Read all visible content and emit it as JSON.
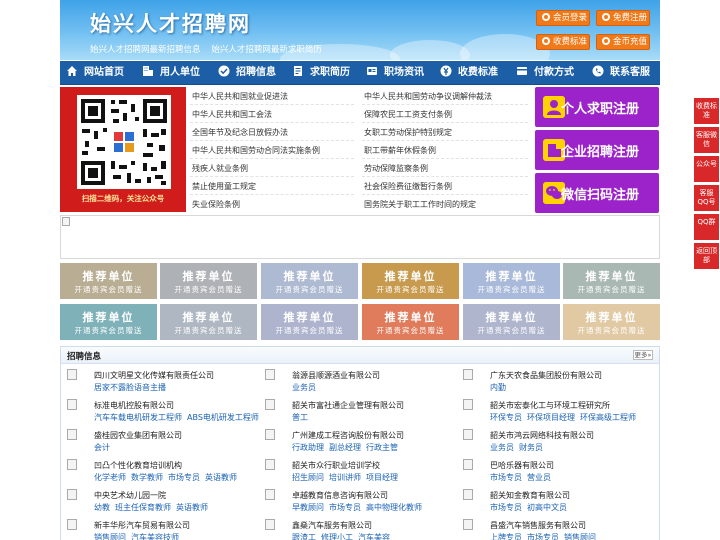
{
  "header": {
    "title": "始兴人才招聘网",
    "subtitle_1": "始兴人才招聘网最新招聘信息",
    "subtitle_2": "始兴人才招聘网最新求职简历",
    "buttons": [
      {
        "label": "会员登录",
        "icon": "user-icon"
      },
      {
        "label": "免费注册",
        "icon": "register-icon"
      },
      {
        "label": "收费标准",
        "icon": "price-icon"
      },
      {
        "label": "金币充值",
        "icon": "coin-icon"
      }
    ]
  },
  "nav": [
    {
      "label": "网站首页",
      "icon": "home-icon"
    },
    {
      "label": "用人单位",
      "icon": "building-icon"
    },
    {
      "label": "招聘信息",
      "icon": "recruit-icon"
    },
    {
      "label": "求职简历",
      "icon": "resume-icon"
    },
    {
      "label": "职场资讯",
      "icon": "news-icon"
    },
    {
      "label": "收费标准",
      "icon": "price-icon"
    },
    {
      "label": "付款方式",
      "icon": "payment-icon"
    },
    {
      "label": "联系客服",
      "icon": "phone-icon"
    }
  ],
  "qr": {
    "caption": "扫描二维码，关注公众号"
  },
  "laws": {
    "left": [
      "中华人民共和国就业促进法",
      "中华人民共和国工会法",
      "全国年节及纪念日放假办法",
      "中华人民共和国劳动合同法实施条例",
      "残疾人就业条例",
      "禁止使用童工规定",
      "失业保险条例"
    ],
    "right": [
      "中华人民共和国劳动争议调解仲裁法",
      "保障农民工工资支付条例",
      "女职工劳动保护特别规定",
      "职工带薪年休假条例",
      "劳动保障监察条例",
      "社会保险费征缴暂行条例",
      "国务院关于职工工作时间的规定"
    ]
  },
  "register": [
    {
      "label": "个人求职注册",
      "icon": "person-icon"
    },
    {
      "label": "企业招聘注册",
      "icon": "company-icon"
    },
    {
      "label": "微信扫码注册",
      "icon": "wechat-icon"
    }
  ],
  "sidebar": [
    {
      "label": "收费标准"
    },
    {
      "label": "客服微信"
    },
    {
      "label": "公众号"
    },
    {
      "label": "客服QQ号"
    },
    {
      "label": "QQ群"
    },
    {
      "label": "返回顶部"
    }
  ],
  "tiles": {
    "title": "推荐单位",
    "subtitle": "开通贵宾会员赠送",
    "colors": [
      "#b9ad93",
      "#aeb1b6",
      "#aebad1",
      "#c79a4e",
      "#a9b9d9",
      "#a9b8b2",
      "#7fb1b9",
      "#aeb7c2",
      "#aeb4ce",
      "#e07b5b",
      "#aeb5cc",
      "#e0c9a3"
    ]
  },
  "jobs": {
    "title": "招聘信息",
    "more": "更多»",
    "columns": [
      [
        {
          "company": "四川文明星文化传媒有限责任公司",
          "positions": [
            "居家不露脸语音主播"
          ]
        },
        {
          "company": "标准电机控股有限公司",
          "positions": [
            "汽车车载电机研发工程师",
            "ABS电机研发工程师"
          ]
        },
        {
          "company": "盛桂园农业集团有限公司",
          "positions": [
            "会计"
          ]
        },
        {
          "company": "凹凸个性化教育培训机构",
          "positions": [
            "化学老师",
            "数学教师",
            "市场专员",
            "英语教师"
          ]
        },
        {
          "company": "中央艺术幼儿园一院",
          "positions": [
            "幼教",
            "班主任保育教师",
            "英语教师"
          ]
        },
        {
          "company": "新丰华彤汽车贸易有限公司",
          "positions": [
            "销售顾问",
            "汽车美容技师"
          ]
        }
      ],
      [
        {
          "company": "翁源县顺源酒业有限公司",
          "positions": [
            "业务员"
          ]
        },
        {
          "company": "韶关市富社通企业管理有限公司",
          "positions": [
            "普工"
          ]
        },
        {
          "company": "广州建成工程咨询股份有限公司",
          "positions": [
            "行政助理",
            "副总经理",
            "行政主管"
          ]
        },
        {
          "company": "韶关市众行职业培训学校",
          "positions": [
            "招生顾问",
            "培训讲师",
            "项目经理"
          ]
        },
        {
          "company": "卓越教育信息咨询有限公司",
          "positions": [
            "早教顾问",
            "市场专员",
            "高中物理化教师"
          ]
        },
        {
          "company": "鑫燊汽车服务有限公司",
          "positions": [
            "跟渣工",
            "修理小工",
            "汽车美容"
          ]
        }
      ],
      [
        {
          "company": "广东天农食品集团股份有限公司",
          "positions": [
            "内勤"
          ]
        },
        {
          "company": "韶关市宏泰化工与环境工程研究所",
          "positions": [
            "环保专员",
            "环保项目经理",
            "环保高级工程师"
          ]
        },
        {
          "company": "韶关市鸿云网络科技有限公司",
          "positions": [
            "业务员",
            "财务员"
          ]
        },
        {
          "company": "巴哈乐器有限公司",
          "positions": [
            "市场专员",
            "营业员"
          ]
        },
        {
          "company": "韶关知金教育有限公司",
          "positions": [
            "市场专员",
            "初高中文员"
          ]
        },
        {
          "company": "昌盛汽车销售服务有限公司",
          "positions": [
            "上牌专员",
            "市场专员",
            "销售顾问"
          ]
        }
      ]
    ]
  },
  "colors": {
    "nav_bg": "#1d5fa6",
    "header_button": "#f07a1a",
    "register_bg": "#9b23c9",
    "sidebar_bg": "#d9282a",
    "qr_bg": "#d11c1c"
  }
}
